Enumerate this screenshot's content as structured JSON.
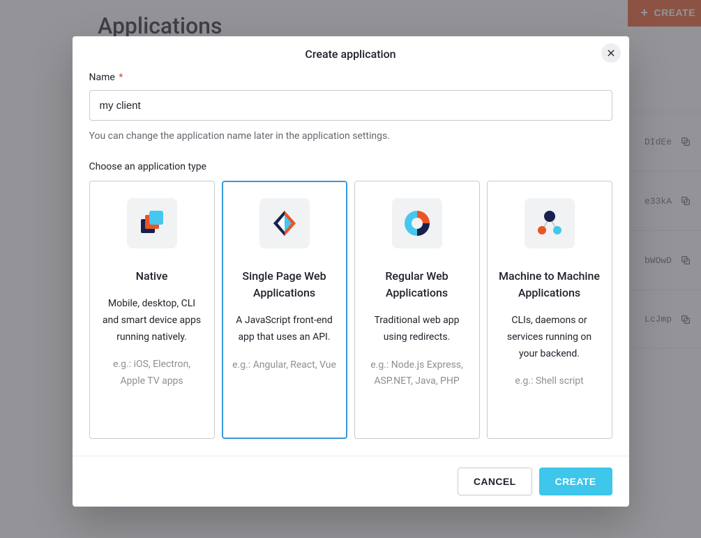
{
  "page": {
    "title": "Applications",
    "create_button": "CREATE"
  },
  "bg_rows": [
    {
      "id": "DIdEe"
    },
    {
      "id": "e33kA"
    },
    {
      "id": "bWOwD"
    },
    {
      "id": "LcJmp"
    }
  ],
  "modal": {
    "title": "Create application",
    "name_label": "Name",
    "name_required": "*",
    "name_value": "my client",
    "name_hint": "You can change the application name later in the application settings.",
    "type_section_label": "Choose an application type",
    "types": [
      {
        "id": "native",
        "title": "Native",
        "desc": "Mobile, desktop, CLI and smart device apps running natively.",
        "eg": "e.g.: iOS, Electron, Apple TV apps",
        "selected": false
      },
      {
        "id": "spa",
        "title": "Single Page Web Applications",
        "desc": "A JavaScript front-end app that uses an API.",
        "eg": "e.g.: Angular, React, Vue",
        "selected": true
      },
      {
        "id": "regular",
        "title": "Regular Web Applications",
        "desc": "Traditional web app using redirects.",
        "eg": "e.g.: Node.js Express, ASP.NET, Java, PHP",
        "selected": false
      },
      {
        "id": "m2m",
        "title": "Machine to Machine Applications",
        "desc": "CLIs, daemons or services running on your backend.",
        "eg": "e.g.: Shell script",
        "selected": false
      }
    ],
    "cancel_label": "CANCEL",
    "submit_label": "CREATE"
  }
}
